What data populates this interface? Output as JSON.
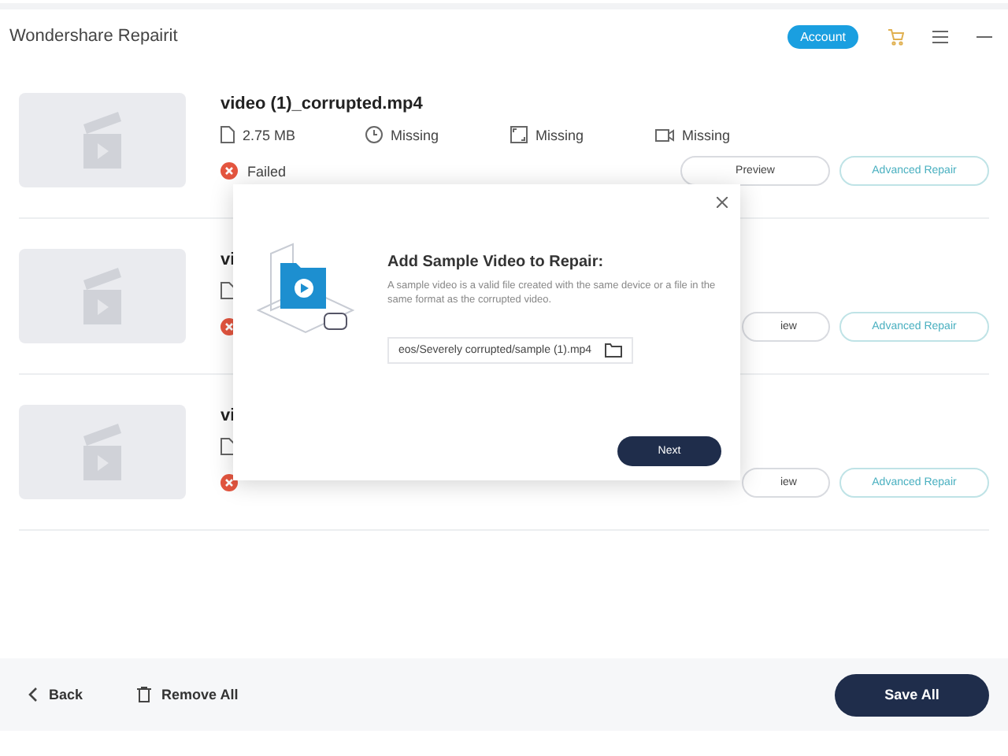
{
  "window": {
    "title": "Wondershare Repairit",
    "account_button": "Account"
  },
  "files": [
    {
      "name": "video (1)_corrupted.mp4",
      "size": "2.75  MB",
      "duration": "Missing",
      "resolution": "Missing",
      "codec": "Missing",
      "status": "Failed",
      "preview": "Preview",
      "advanced": "Advanced Repair"
    },
    {
      "name": "vi",
      "preview": "iew",
      "advanced": "Advanced Repair"
    },
    {
      "name": "vi",
      "preview": "iew",
      "advanced": "Advanced Repair"
    }
  ],
  "dialog": {
    "title": "Add Sample Video to Repair:",
    "description": "A sample video is a valid file created with the same device or a file in the same format as the corrupted video.",
    "path": "eos/Severely corrupted/sample (1).mp4",
    "next": "Next"
  },
  "footer": {
    "back": "Back",
    "remove_all": "Remove All",
    "save_all": "Save All"
  }
}
